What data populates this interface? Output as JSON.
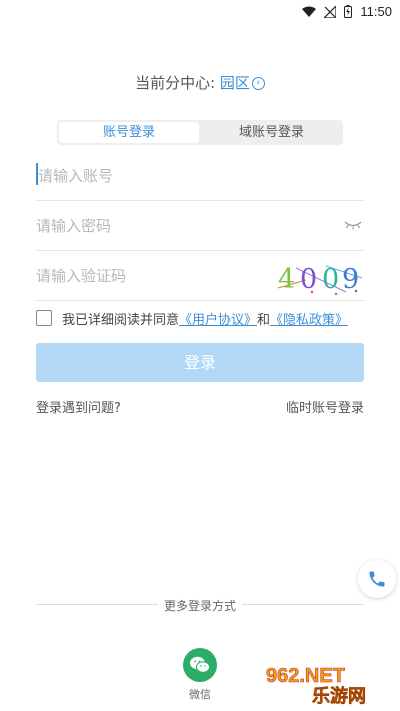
{
  "status_bar": {
    "time": "11:50",
    "icons": [
      "wifi-icon",
      "signal-off-icon",
      "battery-icon"
    ]
  },
  "center": {
    "label": "当前分中心:",
    "value": "园区"
  },
  "tabs": [
    {
      "label": "账号登录",
      "active": true
    },
    {
      "label": "域账号登录",
      "active": false
    }
  ],
  "fields": {
    "account_placeholder": "请输入账号",
    "password_placeholder": "请输入密码",
    "captcha_placeholder": "请输入验证码",
    "captcha_code": [
      "4",
      "0",
      "0",
      "9"
    ]
  },
  "agreement": {
    "checked": false,
    "text_before": "我已详细阅读并同意",
    "user_agreement": "《用户协议》",
    "and": "和",
    "privacy_policy": "《隐私政策》"
  },
  "login_button": "登录",
  "links": {
    "problem": "登录遇到问题?",
    "temp_account": "临时账号登录"
  },
  "more_login": {
    "label": "更多登录方式",
    "wechat": "微信"
  },
  "watermark": {
    "text_top": "962.NET",
    "text_bottom": "乐游网"
  },
  "colors": {
    "accent": "#3b8fd8",
    "button_disabled": "#b3d8f7",
    "wechat": "#2aae67"
  }
}
